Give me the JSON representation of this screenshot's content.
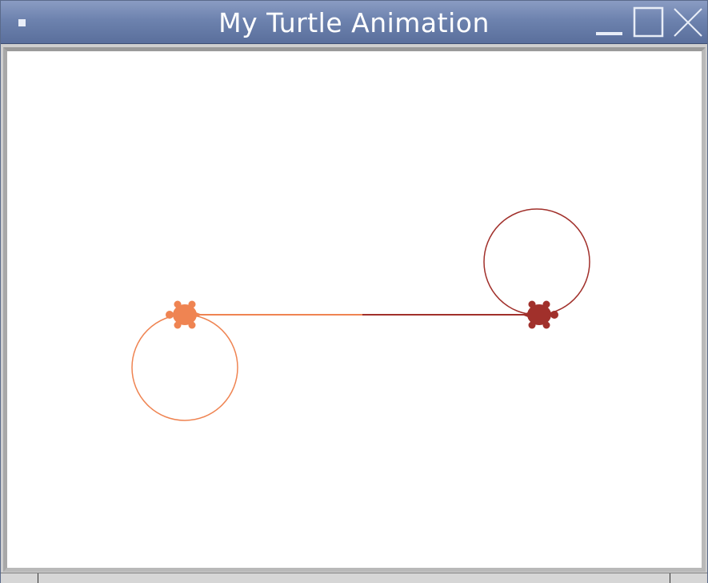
{
  "window": {
    "title": "My Turtle Animation",
    "controls": {
      "menu": "window-menu-icon",
      "minimize": "minimize-icon",
      "maximize": "maximize-icon",
      "close": "close-icon"
    }
  },
  "canvas": {
    "background": "#ffffff",
    "turtles": [
      {
        "name": "orange-turtle",
        "color": "#ef8452",
        "icon": "turtle-icon"
      },
      {
        "name": "dark-red-turtle",
        "color": "#a1302b",
        "icon": "turtle-icon"
      }
    ],
    "drawing": {
      "orange_circle_color": "#ef8452",
      "red_circle_color": "#a1302b"
    }
  }
}
